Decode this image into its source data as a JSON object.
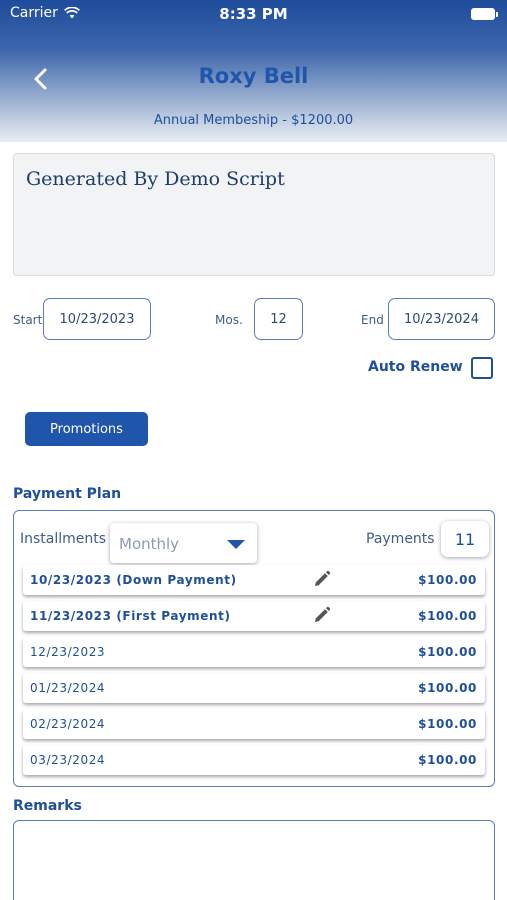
{
  "status_bar": {
    "carrier": "Carrier",
    "time": "8:33 PM"
  },
  "header": {
    "title": "Roxy Bell",
    "subtitle": "Annual Membeship - $1200.00"
  },
  "notes": {
    "text": "Generated By Demo Script"
  },
  "membership": {
    "start_label": "Start",
    "start_value": "10/23/2023",
    "months_label": "Mos.",
    "months_value": "12",
    "end_label": "End",
    "end_value": "10/23/2024",
    "auto_renew_label": "Auto Renew",
    "auto_renew_checked": false
  },
  "promotions_label": "Promotions",
  "payment_plan": {
    "label": "Payment Plan",
    "installments_label": "Installments",
    "installments_value": "Monthly",
    "payments_label": "Payments",
    "payments_value": "11",
    "rows": [
      {
        "date": "10/23/2023 (Down Payment)",
        "amount": "$100.00",
        "editable": true
      },
      {
        "date": "11/23/2023 (First Payment)",
        "amount": "$100.00",
        "editable": true
      },
      {
        "date": "12/23/2023",
        "amount": "$100.00",
        "editable": false
      },
      {
        "date": "01/23/2024",
        "amount": "$100.00",
        "editable": false
      },
      {
        "date": "02/23/2024",
        "amount": "$100.00",
        "editable": false
      },
      {
        "date": "03/23/2024",
        "amount": "$100.00",
        "editable": false
      }
    ]
  },
  "remarks": {
    "label": "Remarks",
    "value": ""
  },
  "colors": {
    "brand": "#1f56ab",
    "text": "#1f4f99",
    "border": "#5a7fb8"
  },
  "icons": {
    "back": "chevron-left-icon",
    "wifi": "wifi-icon",
    "battery": "battery-icon",
    "edit": "pencil-icon",
    "dropdown": "caret-down-icon"
  }
}
